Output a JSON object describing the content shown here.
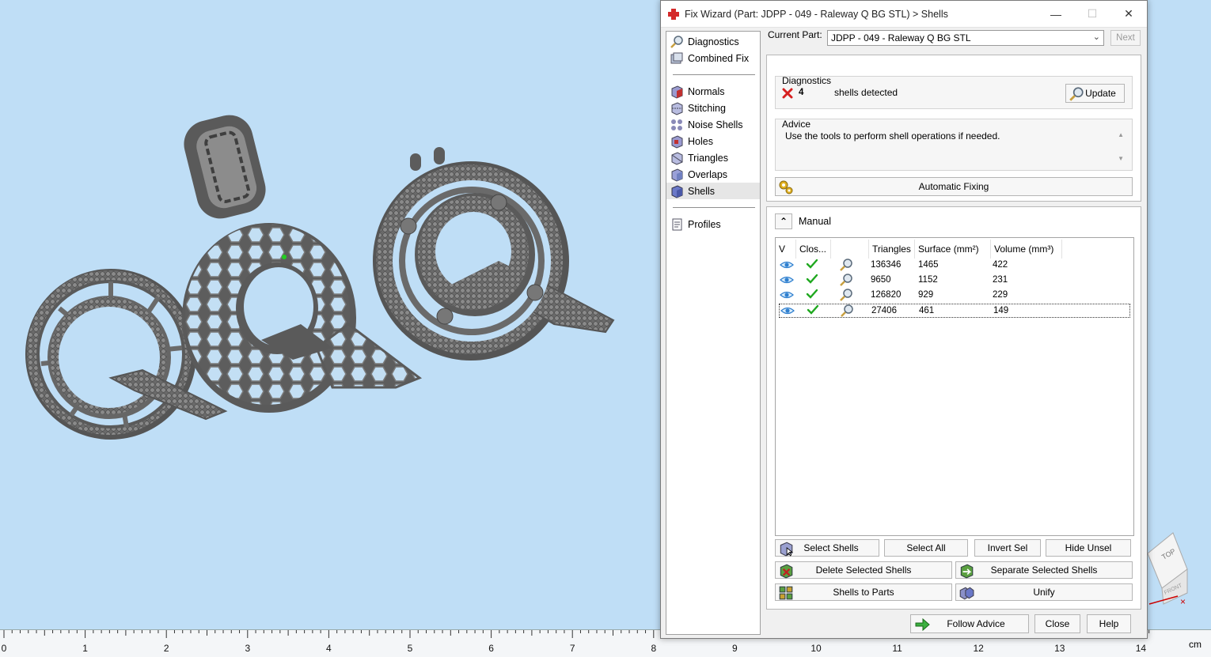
{
  "dialog": {
    "title": "Fix Wizard (Part: JDPP - 049 - Raleway Q BG STL) > Shells",
    "minimize": "—",
    "maximize": "☐",
    "close": "✕"
  },
  "nav": {
    "items": [
      {
        "label": "Diagnostics",
        "icon": "magnifier-icon"
      },
      {
        "label": "Combined Fix",
        "icon": "combined-fix-icon"
      },
      {
        "label": "Normals",
        "icon": "normals-icon"
      },
      {
        "label": "Stitching",
        "icon": "stitching-icon"
      },
      {
        "label": "Noise Shells",
        "icon": "noise-shells-icon"
      },
      {
        "label": "Holes",
        "icon": "holes-icon"
      },
      {
        "label": "Triangles",
        "icon": "triangles-icon"
      },
      {
        "label": "Overlaps",
        "icon": "overlaps-icon"
      },
      {
        "label": "Shells",
        "icon": "shells-icon"
      },
      {
        "label": "Profiles",
        "icon": "profiles-icon"
      }
    ],
    "active": "Shells"
  },
  "current_part": {
    "label": "Current Part:",
    "value": "JDPP - 049 - Raleway Q BG STL",
    "next_label": "Next"
  },
  "diagnostics": {
    "group_label": "Diagnostics",
    "count": "4",
    "message": "shells detected",
    "update_label": "Update"
  },
  "advice": {
    "group_label": "Advice",
    "text": "Use the tools to perform shell operations if needed.",
    "scroll_up": "▲",
    "scroll_down": "▼"
  },
  "automatic_fixing_label": "Automatic Fixing",
  "manual": {
    "label": "Manual",
    "collapse_glyph": "⌃",
    "columns": [
      "V",
      "Clos...",
      "",
      "Triangles",
      "Surface (mm²)",
      "Volume (mm³)"
    ],
    "rows": [
      {
        "triangles": "136346",
        "surface": "1465",
        "volume": "422",
        "selected": false
      },
      {
        "triangles": "9650",
        "surface": "1152",
        "volume": "231",
        "selected": false
      },
      {
        "triangles": "126820",
        "surface": "929",
        "volume": "229",
        "selected": false
      },
      {
        "triangles": "27406",
        "surface": "461",
        "volume": "149",
        "selected": true
      }
    ],
    "buttons": {
      "select_shells": "Select Shells",
      "select_all": "Select All",
      "invert_sel": "Invert Sel",
      "hide_unsel": "Hide Unsel",
      "delete_selected": "Delete Selected Shells",
      "separate_selected": "Separate Selected Shells",
      "shells_to_parts": "Shells to Parts",
      "unify": "Unify"
    }
  },
  "bottom": {
    "follow_advice": "Follow Advice",
    "close": "Close",
    "help": "Help"
  },
  "ruler": {
    "ticks": [
      "0",
      "1",
      "2",
      "3",
      "4",
      "5",
      "6",
      "7",
      "8",
      "9",
      "10",
      "11",
      "12",
      "13",
      "14"
    ],
    "unit": "cm"
  },
  "viewcube": {
    "top": "TOP",
    "front": "FRONT"
  },
  "colors": {
    "viewport_bg": "#bfdef6",
    "model": "#6e6e6e",
    "check": "#1fa81f",
    "error": "#d62020",
    "eye": "#2f7fcf"
  }
}
